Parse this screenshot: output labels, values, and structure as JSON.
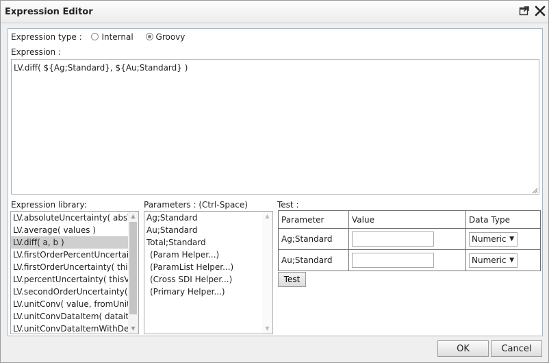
{
  "window": {
    "title": "Expression Editor",
    "popout_icon": "popout-window-icon",
    "close_icon": "close-icon"
  },
  "expression_type": {
    "label": "Expression type :",
    "options": [
      "Internal",
      "Groovy"
    ],
    "selected": "Groovy"
  },
  "expression": {
    "label": "Expression :",
    "value": "LV.diff( ${Ag;Standard}, ${Au;Standard} )"
  },
  "library": {
    "label": "Expression library:",
    "items": [
      "LV.absoluteUncertainty( absVa",
      "LV.average( values )",
      "LV.diff( a, b )",
      "LV.firstOrderPercentUncertain",
      "LV.firstOrderUncertainty( this\\",
      "LV.percentUncertainty( thisVal",
      "LV.secondOrderUncertainty( th",
      "LV.unitConv( value, fromUnit, t",
      "LV.unitConvDataItem( dataiter",
      "LV.unitConvDataItemWithDen"
    ],
    "selected_index": 2
  },
  "parameters": {
    "label": "Parameters : (Ctrl-Space)",
    "items": [
      "Ag;Standard",
      "Au;Standard",
      "Total;Standard",
      "(Param Helper...)",
      "(ParamList Helper...)",
      "(Cross SDI Helper...)",
      "(Primary Helper...)"
    ]
  },
  "test": {
    "label": "Test :",
    "columns": [
      "Parameter",
      "Value",
      "Data Type"
    ],
    "rows": [
      {
        "parameter": "Ag;Standard",
        "value": "",
        "data_type": "Numeric"
      },
      {
        "parameter": "Au;Standard",
        "value": "",
        "data_type": "Numeric"
      }
    ],
    "button_label": "Test"
  },
  "footer": {
    "ok_label": "OK",
    "cancel_label": "Cancel"
  },
  "colors": {
    "selection": "#cfcfcf",
    "content_border": "#9fb8cf",
    "dialog_bg": "#efefef"
  }
}
